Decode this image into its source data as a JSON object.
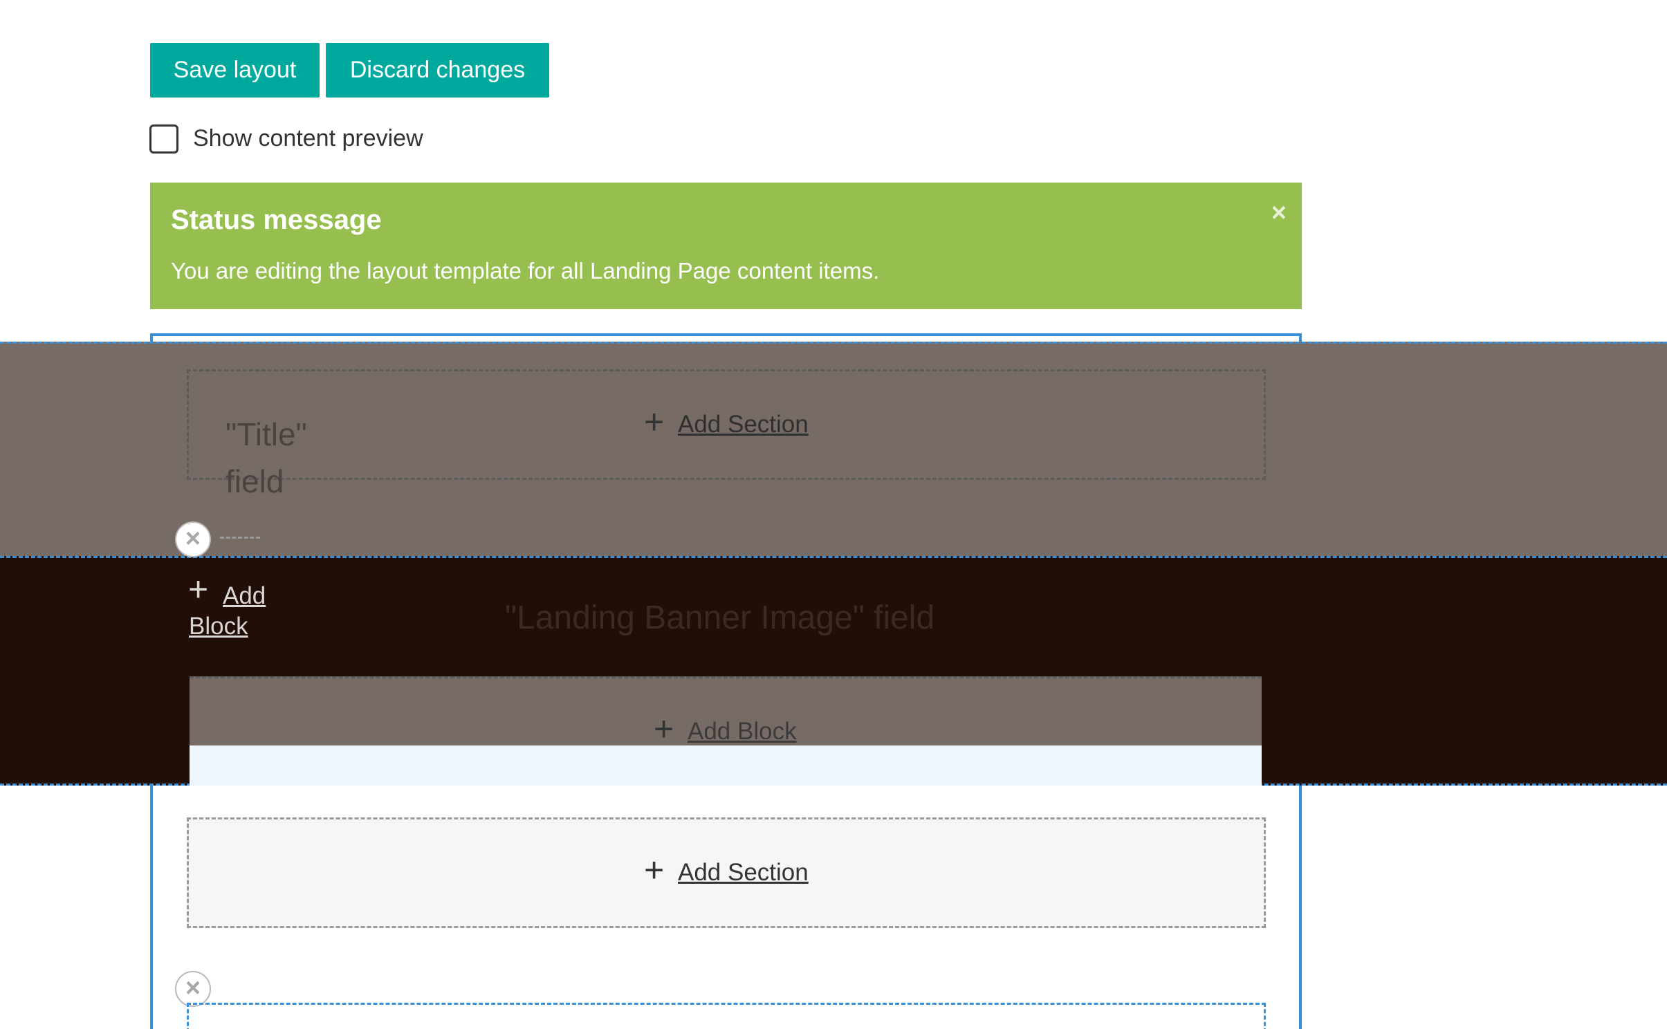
{
  "toolbar": {
    "save_label": "Save layout",
    "discard_label": "Discard changes"
  },
  "preview": {
    "label": "Show content preview",
    "checked": false
  },
  "status": {
    "title": "Status message",
    "text": "You are editing the layout template for all Landing Page content items.",
    "close_glyph": "×"
  },
  "layout": {
    "add_section_label": "Add Section",
    "add_block_label": "Add Block",
    "add_block_left_line1": "Add",
    "add_block_left_line2": "Block",
    "title_field": "\"Title\" field",
    "banner_field": "\"Landing Banner Image\" field",
    "plus_glyph": "+",
    "remove_glyph": "×"
  },
  "colors": {
    "button": "#00a99d",
    "status_bg": "#97bf50",
    "outline": "#3a8fd6",
    "gray_band": "#776b66",
    "dark_band": "#200e07"
  },
  "icons": {
    "remove": "close-circle-icon",
    "add": "plus-icon",
    "dismiss": "close-icon"
  }
}
